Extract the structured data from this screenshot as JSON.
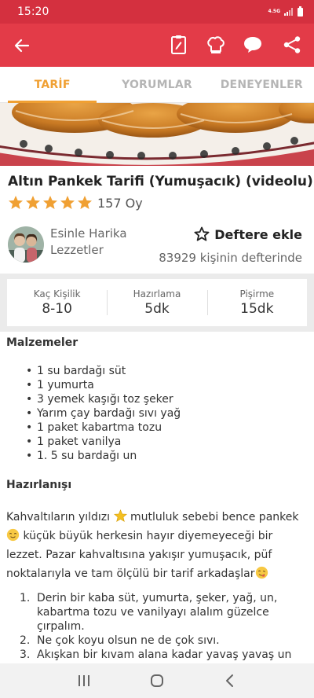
{
  "status": {
    "time": "15:20",
    "network": "4.5G"
  },
  "toolbar": {
    "back_icon": "arrow-left-icon",
    "icons": [
      "clipboard-pen-icon",
      "chef-hat-icon",
      "chat-bubble-icon",
      "share-icon"
    ]
  },
  "tabs": [
    {
      "label": "TARİF",
      "active": true
    },
    {
      "label": "YORUMLAR",
      "active": false
    },
    {
      "label": "DENEYENLER",
      "active": false
    }
  ],
  "recipe": {
    "title": "Altın Pankek Tarifi (Yumuşacık) (videolu)",
    "rating": 5,
    "rating_count": "157 Oy",
    "author": "Esinle Harika Lezzetler",
    "save_label": "Deftere ekle",
    "save_count": "83929 kişinin defterinde"
  },
  "info": [
    {
      "label": "Kaç Kişilik",
      "value": "8-10"
    },
    {
      "label": "Hazırlama",
      "value": "5dk"
    },
    {
      "label": "Pişirme",
      "value": "15dk"
    }
  ],
  "ingredients_title": "Malzemeler",
  "ingredients": [
    "1 su bardağı süt",
    "1 yumurta",
    "3 yemek kaşığı toz şeker",
    "Yarım çay bardağı sıvı yağ",
    "1 paket kabartma tozu",
    "1 paket vanilya",
    "1. 5 su bardağı un"
  ],
  "preparation_title": "Hazırlanışı",
  "intro": {
    "part1": "Kahvaltıların yıldızı ",
    "part2": " mutluluk sebebi bence pankek",
    "part3": " küçük büyük herkesin hayır diyemeyeceği bir lezzet. Pazar kahvaltısına yakışır yumuşacık, püf noktalarıyla ve tam ölçülü bir tarif arkadaşlar"
  },
  "steps": [
    {
      "num": "1.",
      "text": "Derin bir kaba süt, yumurta, şeker, yağ, un, kabartma tozu ve vanilyayı alalım güzelce çırpalım."
    },
    {
      "num": "2.",
      "text": "Ne çok koyu olsun ne de çok sıvı."
    },
    {
      "num": "3.",
      "text": "Akışkan bir kıvam alana kadar yavaş yavaş un"
    }
  ],
  "colors": {
    "status": "#d4303f",
    "appbar": "#e33b48",
    "accent": "#f0a033",
    "star": "#f0a033"
  },
  "nav": [
    "recent-apps-icon",
    "home-icon",
    "back-icon"
  ]
}
